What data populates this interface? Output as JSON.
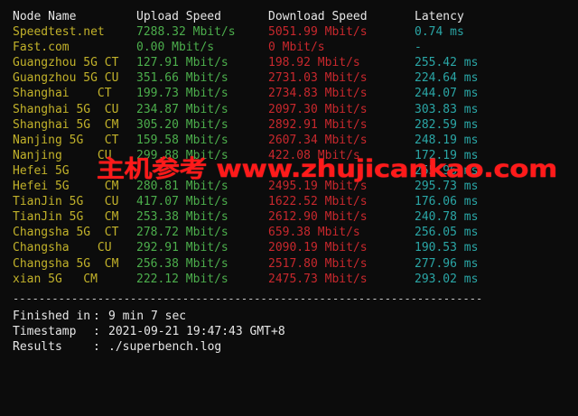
{
  "colors": {
    "node": "#c2b22a",
    "upload": "#4cae4c",
    "download": "#c8282d",
    "latency": "#2aa6a6",
    "separator": "#c8c8c8",
    "watermark": "#ff1a1a"
  },
  "header": {
    "node": "Node Name",
    "upload": "Upload Speed",
    "download": "Download Speed",
    "latency": "Latency"
  },
  "rows": [
    {
      "node": "Speedtest.net",
      "upload": "7288.32 Mbit/s",
      "download": "5051.99 Mbit/s",
      "latency": "0.74 ms"
    },
    {
      "node": "Fast.com",
      "upload": "0.00 Mbit/s",
      "download": "0 Mbit/s",
      "latency": "-"
    },
    {
      "node": "Guangzhou 5G CT",
      "upload": "127.91 Mbit/s",
      "download": "198.92 Mbit/s",
      "latency": "255.42 ms"
    },
    {
      "node": "Guangzhou 5G CU",
      "upload": "351.66 Mbit/s",
      "download": "2731.03 Mbit/s",
      "latency": "224.64 ms"
    },
    {
      "node": "Shanghai    CT",
      "upload": "199.73 Mbit/s",
      "download": "2734.83 Mbit/s",
      "latency": "244.07 ms"
    },
    {
      "node": "Shanghai 5G  CU",
      "upload": "234.87 Mbit/s",
      "download": "2097.30 Mbit/s",
      "latency": "303.83 ms"
    },
    {
      "node": "Shanghai 5G  CM",
      "upload": "305.20 Mbit/s",
      "download": "2892.91 Mbit/s",
      "latency": "282.59 ms"
    },
    {
      "node": "Nanjing 5G   CT",
      "upload": "159.58 Mbit/s",
      "download": "2607.34 Mbit/s",
      "latency": "248.19 ms"
    },
    {
      "node": "Nanjing     CU",
      "upload": "299.88 Mbit/s",
      "download": "422.08 Mbit/s",
      "latency": "172.19 ms"
    },
    {
      "node": "Hefei 5G",
      "upload": "",
      "download": "",
      "latency": "255.96 ms"
    },
    {
      "node": "Hefei 5G     CM",
      "upload": "280.81 Mbit/s",
      "download": "2495.19 Mbit/s",
      "latency": "295.73 ms"
    },
    {
      "node": "TianJin 5G   CU",
      "upload": "417.07 Mbit/s",
      "download": "1622.52 Mbit/s",
      "latency": "176.06 ms"
    },
    {
      "node": "TianJin 5G   CM",
      "upload": "253.38 Mbit/s",
      "download": "2612.90 Mbit/s",
      "latency": "240.78 ms"
    },
    {
      "node": "Changsha 5G  CT",
      "upload": "278.72 Mbit/s",
      "download": "659.38 Mbit/s",
      "latency": "256.05 ms"
    },
    {
      "node": "Changsha    CU",
      "upload": "292.91 Mbit/s",
      "download": "2090.19 Mbit/s",
      "latency": "190.53 ms"
    },
    {
      "node": "Changsha 5G  CM",
      "upload": "256.38 Mbit/s",
      "download": "2517.80 Mbit/s",
      "latency": "277.96 ms"
    },
    {
      "node": "xian 5G   CM",
      "upload": "222.12 Mbit/s",
      "download": "2475.73 Mbit/s",
      "latency": "293.02 ms"
    }
  ],
  "separator": "------------------------------------------------------------------------",
  "summary": [
    {
      "label": "Finished in",
      "value": "9 min 7 sec"
    },
    {
      "label": "Timestamp",
      "value": "2021-09-21 19:47:43 GMT+8"
    },
    {
      "label": "Results",
      "value": "./superbench.log"
    }
  ],
  "watermark": "主机参考 www.zhujicankao.com"
}
